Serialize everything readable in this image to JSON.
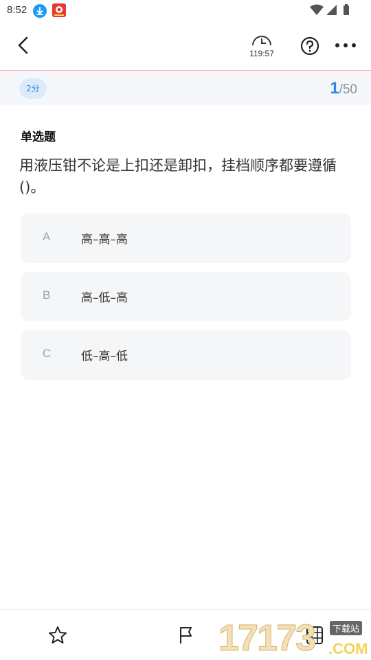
{
  "status": {
    "time": "8:52"
  },
  "header": {
    "timer": "119:57"
  },
  "score": {
    "badge": "2分",
    "current": "1",
    "total": "/50"
  },
  "question": {
    "type": "单选题",
    "text": "用液压钳不论是上扣还是卸扣，挂档顺序都要遵循()。",
    "options": [
      {
        "letter": "A",
        "text": "高–高–高"
      },
      {
        "letter": "B",
        "text": "高–低–高"
      },
      {
        "letter": "C",
        "text": "低–高–低"
      }
    ]
  },
  "watermark": {
    "number": "17173",
    "tag": "下载站",
    "domain": ".COM"
  },
  "colors": {
    "accent": "#2b8ae6",
    "divider": "#f1b3b3",
    "option_bg": "#f5f6f8"
  },
  "icons": [
    "download-icon",
    "app-icon",
    "wifi-icon",
    "signal-icon",
    "battery-icon",
    "back-icon",
    "clock-icon",
    "help-icon",
    "more-icon",
    "star-icon",
    "flag-icon",
    "grid-icon"
  ]
}
